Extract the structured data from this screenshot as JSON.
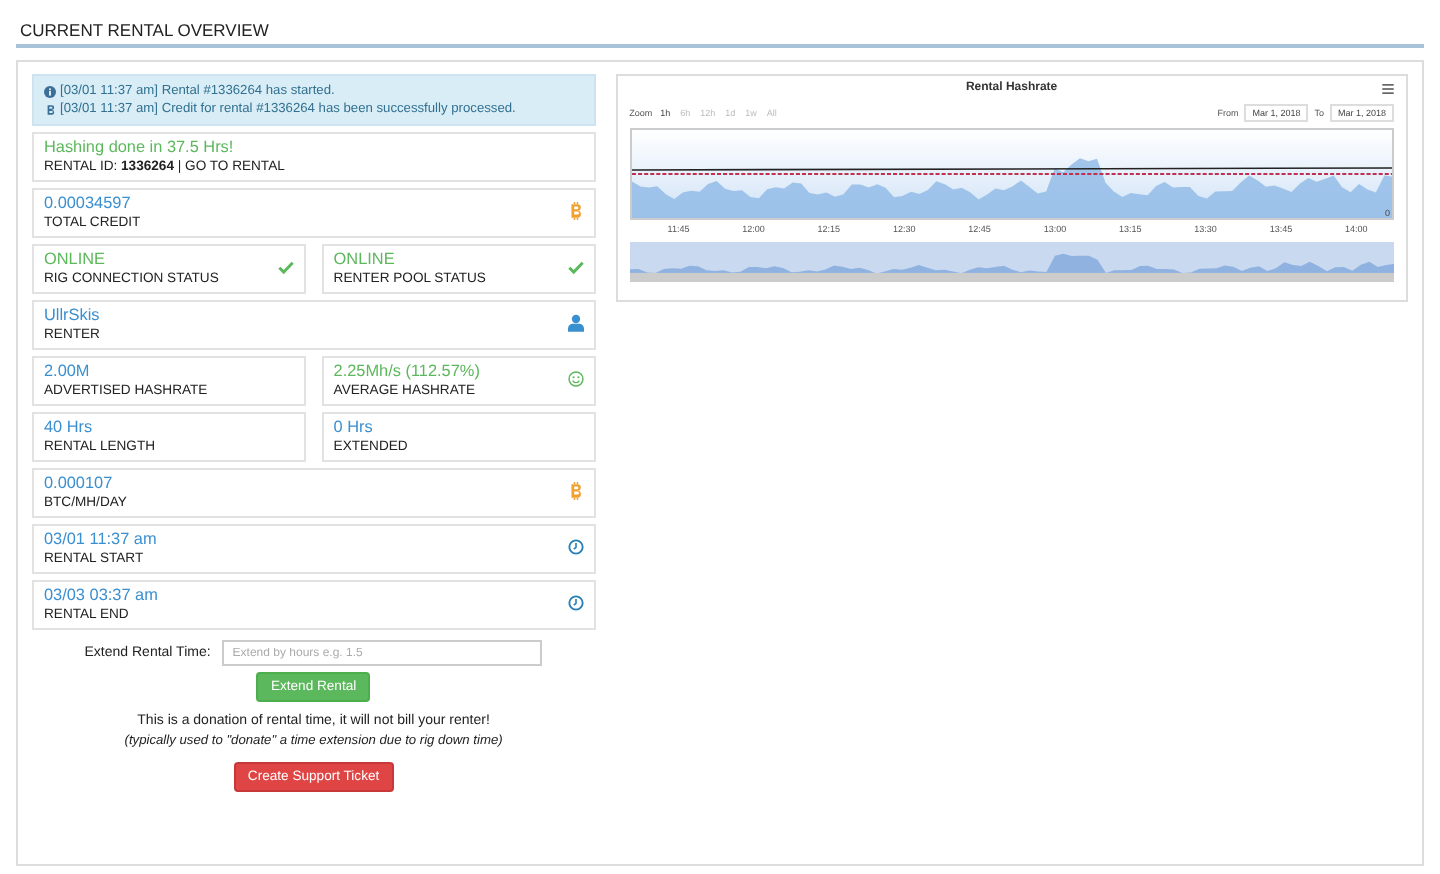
{
  "heading": "CURRENT RENTAL OVERVIEW",
  "alerts": [
    {
      "kind": "info",
      "text": "[03/01 11:37 am] Rental #1336264 has started."
    },
    {
      "kind": "credit",
      "text": "[03/01 11:37 am] Credit for rental #1336264 has been successfully processed."
    }
  ],
  "summary": {
    "status": "Hashing done in 37.5 Hrs!",
    "rental_id": "RENTAL ID: **1336264** | GO TO RENTAL"
  },
  "rows": [
    [
      {
        "value": "0.00034597",
        "label": "TOTAL CREDIT",
        "color": "#3a8fd0",
        "kind": "coin"
      }
    ],
    [
      {
        "value": "ONLINE",
        "label": "RIG CONNECTION STATUS",
        "color": "#5cb85c",
        "kind": "check"
      },
      {
        "value": "ONLINE",
        "label": "RENTER POOL STATUS",
        "color": "#5cb85c",
        "kind": "check"
      }
    ],
    [
      {
        "value": "UllrSkis",
        "label": "RENTER",
        "color": "#3a8fd0",
        "kind": "user"
      }
    ],
    [
      {
        "value": "2.00M",
        "label": "ADVERTISED HASHRATE",
        "color": "#3a8fd0",
        "kind": "none"
      },
      {
        "value": "2.25Mh/s (112.57%)",
        "label": "AVERAGE HASHRATE",
        "color": "#5cb85c",
        "kind": "smile"
      }
    ],
    [
      {
        "value": "40 Hrs",
        "label": "RENTAL LENGTH",
        "color": "#3a8fd0",
        "kind": "none"
      },
      {
        "value": "0 Hrs",
        "label": "EXTENDED",
        "color": "#3a8fd0",
        "kind": "none"
      }
    ],
    [
      {
        "value": "0.000107",
        "label": "BTC/MH/DAY",
        "color": "#3a8fd0",
        "kind": "coin"
      }
    ],
    [
      {
        "value": "03/01 11:37 am",
        "label": "RENTAL START",
        "color": "#3a8fd0",
        "kind": "clock"
      }
    ],
    [
      {
        "value": "03/03 03:37 am",
        "label": "RENTAL END",
        "color": "#3a8fd0",
        "kind": "clock"
      }
    ]
  ],
  "extend": {
    "label": "Extend Rental Time:",
    "placeholder": "Extend by hours e.g. 1.5",
    "button": "Extend Rental"
  },
  "notice": "This is a donation of rental time, it will not bill your renter!",
  "note": "(typically used to \"donate\" a time extension due to rig down time)",
  "support_button": "Create Support Ticket",
  "chart": {
    "title": "Rental Hashrate",
    "zoom_label": "Zoom",
    "zoom_options": [
      {
        "label": "1h",
        "selected": true
      },
      {
        "label": "6h",
        "selected": false
      },
      {
        "label": "12h",
        "selected": false
      },
      {
        "label": "1d",
        "selected": false
      },
      {
        "label": "1w",
        "selected": false
      },
      {
        "label": "All",
        "selected": false
      }
    ],
    "from_label": "From",
    "from": "Mar 1, 2018",
    "to_label": "To",
    "to": "Mar 1, 2018",
    "x_labels": [
      "11:45",
      "12:00",
      "12:15",
      "12:30",
      "12:45",
      "13:00",
      "13:15",
      "13:30",
      "13:45",
      "14:00"
    ],
    "y_label": "0"
  }
}
